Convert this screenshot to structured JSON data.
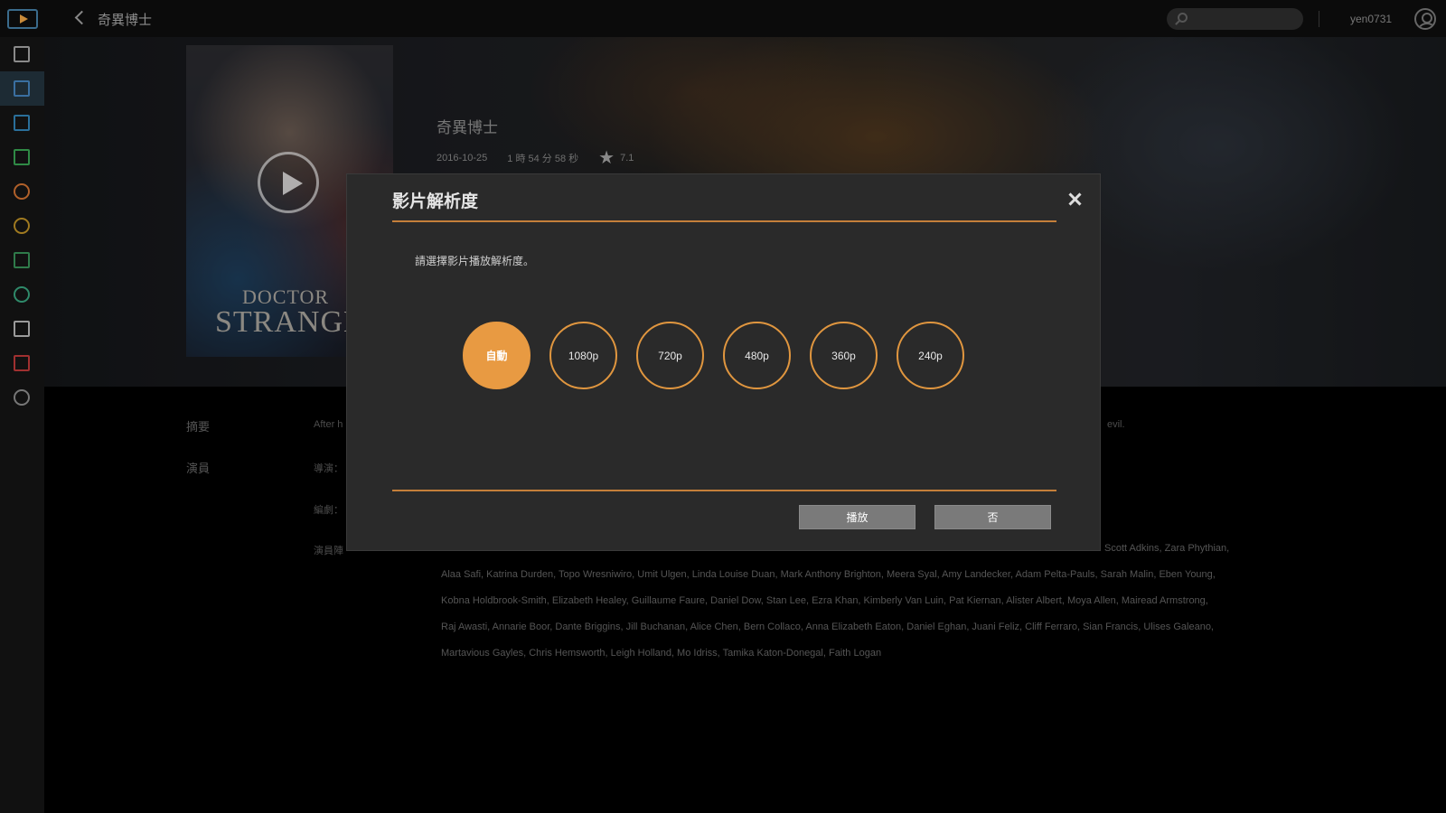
{
  "topbar": {
    "title": "奇異博士",
    "search_placeholder": "",
    "username": "yen0731"
  },
  "sidebar": {
    "items": [
      {
        "icon": "printer-icon",
        "color": "#8a8a8a"
      },
      {
        "icon": "library-icon",
        "color": "#3a6fa0",
        "active": true
      },
      {
        "icon": "tv-icon",
        "color": "#2a6f9a"
      },
      {
        "icon": "list-icon",
        "color": "#2f8a45"
      },
      {
        "icon": "heart-icon",
        "color": "#b0602a"
      },
      {
        "icon": "clock-icon",
        "color": "#a07a20"
      },
      {
        "icon": "tag-icon",
        "color": "#2f7a4a"
      },
      {
        "icon": "refresh-icon",
        "color": "#2f8a6a"
      },
      {
        "icon": "folder-icon",
        "color": "#9a9a9a"
      },
      {
        "icon": "tape-icon",
        "color": "#a03030"
      },
      {
        "icon": "gear-icon",
        "color": "#777777"
      }
    ]
  },
  "movie": {
    "poster_line1": "DOCTOR",
    "poster_line2": "STRANGE",
    "title": "奇異博士",
    "date": "2016-10-25",
    "duration": "1 時 54 分 58 秒",
    "rating": "7.1"
  },
  "details": {
    "summary_label": "摘要",
    "summary_text_left": "After h",
    "summary_text_right": "evil.",
    "cast_label": "演員",
    "director_label": "導演：",
    "writer_label": "編劇：",
    "actors_label": "演員陣",
    "cast_line_1_tail": "Scott Adkins, Zara Phythian,",
    "cast_lines": [
      "Alaa Safi, Katrina Durden, Topo Wresniwiro, Umit Ulgen, Linda Louise Duan, Mark Anthony Brighton, Meera Syal, Amy Landecker, Adam Pelta-Pauls, Sarah Malin, Eben Young,",
      "Kobna Holdbrook-Smith, Elizabeth Healey, Guillaume Faure, Daniel Dow, Stan Lee, Ezra Khan, Kimberly Van Luin, Pat Kiernan, Alister Albert, Moya Allen, Mairead Armstrong,",
      "Raj Awasti, Annarie Boor, Dante Briggins, Jill Buchanan, Alice Chen, Bern Collaco, Anna Elizabeth Eaton, Daniel Eghan, Juani Feliz, Cliff Ferraro, Sian Francis, Ulises Galeano,",
      "Martavious Gayles, Chris Hemsworth, Leigh Holland, Mo Idriss, Tamika Katon-Donegal, Faith Logan"
    ]
  },
  "modal": {
    "title": "影片解析度",
    "description": "請選擇影片播放解析度。",
    "options": [
      "自動",
      "1080p",
      "720p",
      "480p",
      "360p",
      "240p"
    ],
    "selected_index": 0,
    "play_label": "播放",
    "no_label": "否",
    "accent_color": "#e89a42"
  }
}
